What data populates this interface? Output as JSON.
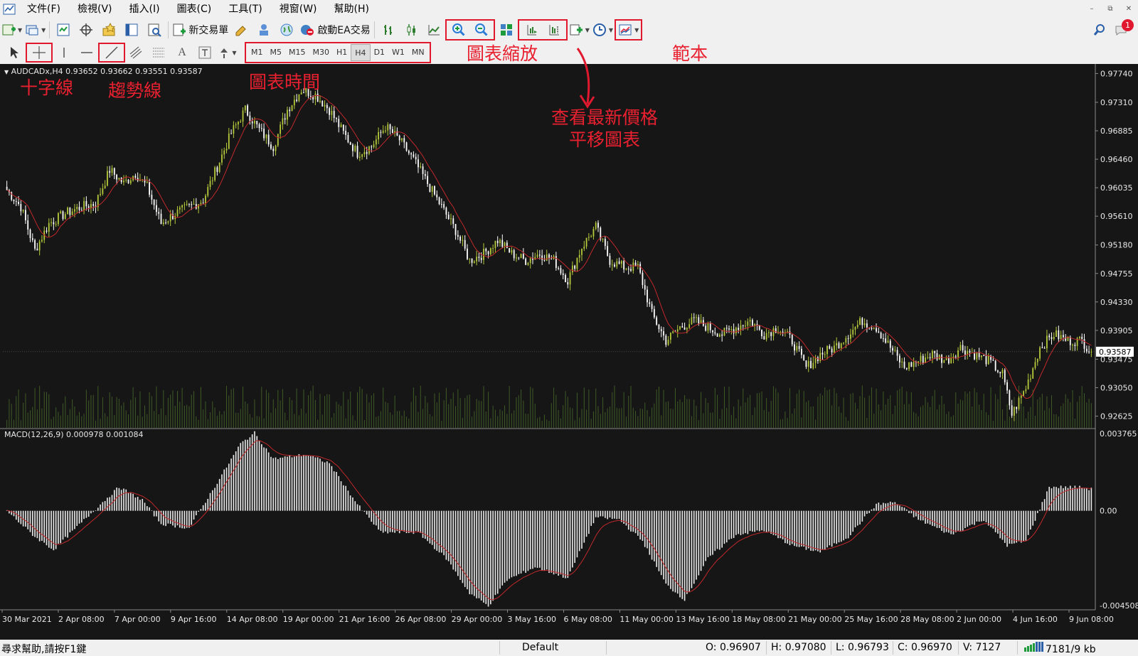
{
  "menu": {
    "items": [
      "文件(F)",
      "檢視(V)",
      "插入(I)",
      "圖表(C)",
      "工具(T)",
      "視窗(W)",
      "幫助(H)"
    ]
  },
  "toolbar": {
    "new_order_label": "新交易單",
    "auto_trading_label": "啟動EA交易",
    "notification_count": "1",
    "timeframes": [
      "M1",
      "M5",
      "M15",
      "M30",
      "H1",
      "H4",
      "D1",
      "W1",
      "MN"
    ],
    "active_timeframe": "H4"
  },
  "chart": {
    "header": "AUDCADx,H4  0.93652 0.93662 0.93551 0.93587",
    "current_price": "0.93587",
    "price_labels": [
      "0.97740",
      "0.97310",
      "0.96885",
      "0.96460",
      "0.96035",
      "0.95610",
      "0.95180",
      "0.94755",
      "0.94330",
      "0.93905",
      "0.93475",
      "0.93050",
      "0.92625"
    ],
    "macd_header": "MACD(12,26,9) 0.000978 0.001084",
    "macd_labels": [
      "0.003765",
      "0.00",
      "-0.004508"
    ],
    "date_labels": [
      "30 Mar 2021",
      "2 Apr 08:00",
      "7 Apr 00:00",
      "9 Apr 16:00",
      "14 Apr 08:00",
      "19 Apr 00:00",
      "21 Apr 16:00",
      "26 Apr 08:00",
      "29 Apr 00:00",
      "3 May 16:00",
      "6 May 08:00",
      "11 May 00:00",
      "13 May 16:00",
      "18 May 08:00",
      "21 May 00:00",
      "25 May 16:00",
      "28 May 08:00",
      "2 Jun 00:00",
      "4 Jun 16:00",
      "9 Jun 08:00"
    ]
  },
  "chart_data": {
    "type": "candlestick",
    "symbol": "AUDCADx",
    "timeframe": "H4",
    "ohlc_header": {
      "open": 0.93652,
      "high": 0.93662,
      "low": 0.93551,
      "close": 0.93587
    },
    "ylim": [
      0.9245,
      0.9784
    ],
    "approx_close_path": [
      [
        0,
        0.96
      ],
      [
        6,
        0.9575
      ],
      [
        12,
        0.951
      ],
      [
        18,
        0.955
      ],
      [
        25,
        0.9565
      ],
      [
        32,
        0.9575
      ],
      [
        38,
        0.958
      ],
      [
        44,
        0.963
      ],
      [
        50,
        0.961
      ],
      [
        55,
        0.9625
      ],
      [
        60,
        0.9605
      ],
      [
        66,
        0.955
      ],
      [
        72,
        0.9565
      ],
      [
        78,
        0.9575
      ],
      [
        84,
        0.9585
      ],
      [
        90,
        0.9635
      ],
      [
        96,
        0.9685
      ],
      [
        102,
        0.972
      ],
      [
        108,
        0.969
      ],
      [
        114,
        0.9665
      ],
      [
        120,
        0.972
      ],
      [
        126,
        0.975
      ],
      [
        132,
        0.9742
      ],
      [
        138,
        0.972
      ],
      [
        144,
        0.9685
      ],
      [
        150,
        0.9655
      ],
      [
        156,
        0.9665
      ],
      [
        162,
        0.9695
      ],
      [
        168,
        0.9675
      ],
      [
        174,
        0.9645
      ],
      [
        180,
        0.961
      ],
      [
        186,
        0.9575
      ],
      [
        192,
        0.954
      ],
      [
        198,
        0.9495
      ],
      [
        204,
        0.9505
      ],
      [
        210,
        0.9525
      ],
      [
        216,
        0.9505
      ],
      [
        222,
        0.9495
      ],
      [
        228,
        0.9505
      ],
      [
        234,
        0.9495
      ],
      [
        240,
        0.9465
      ],
      [
        246,
        0.9515
      ],
      [
        252,
        0.9545
      ],
      [
        258,
        0.9495
      ],
      [
        264,
        0.9485
      ],
      [
        270,
        0.9485
      ],
      [
        276,
        0.9415
      ],
      [
        282,
        0.9375
      ],
      [
        288,
        0.9395
      ],
      [
        294,
        0.9405
      ],
      [
        300,
        0.9395
      ],
      [
        306,
        0.9385
      ],
      [
        312,
        0.9395
      ],
      [
        318,
        0.9405
      ],
      [
        324,
        0.9385
      ],
      [
        330,
        0.9395
      ],
      [
        336,
        0.9375
      ],
      [
        342,
        0.9335
      ],
      [
        348,
        0.9355
      ],
      [
        354,
        0.9365
      ],
      [
        360,
        0.9385
      ],
      [
        366,
        0.9405
      ],
      [
        372,
        0.9395
      ],
      [
        378,
        0.9365
      ],
      [
        384,
        0.9335
      ],
      [
        390,
        0.9345
      ],
      [
        396,
        0.9355
      ],
      [
        402,
        0.9345
      ],
      [
        408,
        0.9365
      ],
      [
        414,
        0.9355
      ],
      [
        420,
        0.9345
      ],
      [
        426,
        0.9325
      ],
      [
        430,
        0.9265
      ],
      [
        436,
        0.9305
      ],
      [
        442,
        0.9365
      ],
      [
        448,
        0.9385
      ],
      [
        454,
        0.9375
      ],
      [
        460,
        0.9375
      ],
      [
        464,
        0.93587
      ]
    ],
    "macd": {
      "name": "MACD(12,26,9)",
      "main": 0.000978,
      "signal": 0.001084,
      "ylim": [
        -0.004508,
        0.003765
      ],
      "approx_hist": [
        [
          0,
          0.0
        ],
        [
          12,
          -0.0012
        ],
        [
          20,
          -0.0018
        ],
        [
          40,
          0.0003
        ],
        [
          48,
          0.0011
        ],
        [
          58,
          0.0005
        ],
        [
          66,
          -0.0006
        ],
        [
          78,
          -0.0008
        ],
        [
          90,
          0.0013
        ],
        [
          100,
          0.0031
        ],
        [
          106,
          0.0036
        ],
        [
          114,
          0.0024
        ],
        [
          128,
          0.0026
        ],
        [
          138,
          0.0022
        ],
        [
          150,
          0.0003
        ],
        [
          160,
          -0.001
        ],
        [
          176,
          -0.001
        ],
        [
          188,
          -0.0022
        ],
        [
          198,
          -0.0038
        ],
        [
          206,
          -0.0044
        ],
        [
          214,
          -0.0032
        ],
        [
          226,
          -0.0026
        ],
        [
          240,
          -0.0031
        ],
        [
          252,
          -0.0003
        ],
        [
          262,
          -0.0004
        ],
        [
          272,
          -0.0014
        ],
        [
          282,
          -0.0034
        ],
        [
          290,
          -0.0041
        ],
        [
          300,
          -0.0022
        ],
        [
          312,
          -0.0011
        ],
        [
          324,
          -0.0009
        ],
        [
          336,
          -0.0016
        ],
        [
          348,
          -0.0019
        ],
        [
          360,
          -0.0012
        ],
        [
          372,
          0.0003
        ],
        [
          380,
          0.0004
        ],
        [
          390,
          -0.0004
        ],
        [
          404,
          -0.0011
        ],
        [
          418,
          -0.0004
        ],
        [
          428,
          -0.0016
        ],
        [
          436,
          -0.0014
        ],
        [
          446,
          0.0011
        ],
        [
          458,
          0.0011
        ],
        [
          464,
          0.001
        ]
      ]
    }
  },
  "annotations": {
    "crosshair": "十字線",
    "trendline": "趨勢線",
    "chart_time": "圖表時間",
    "chart_zoom": "圖表縮放",
    "latest_price_line1": "查看最新價格",
    "latest_price_line2": "平移圖表",
    "template": "範本"
  },
  "status": {
    "help": "尋求幫助,請按F1鍵",
    "profile": "Default",
    "open": "O: 0.96907",
    "high": "H: 0.97080",
    "low": "L: 0.96793",
    "close": "C: 0.96970",
    "volume": "V: 7127",
    "traffic": "7181/9 kb"
  },
  "colors": {
    "chart_bg": "#161616",
    "bull_candle": "#b5c93a",
    "bear_candle": "#ffffff",
    "moving_average": "#c0282b",
    "volume": "#3f5a26",
    "annotation": "#e0192f"
  }
}
